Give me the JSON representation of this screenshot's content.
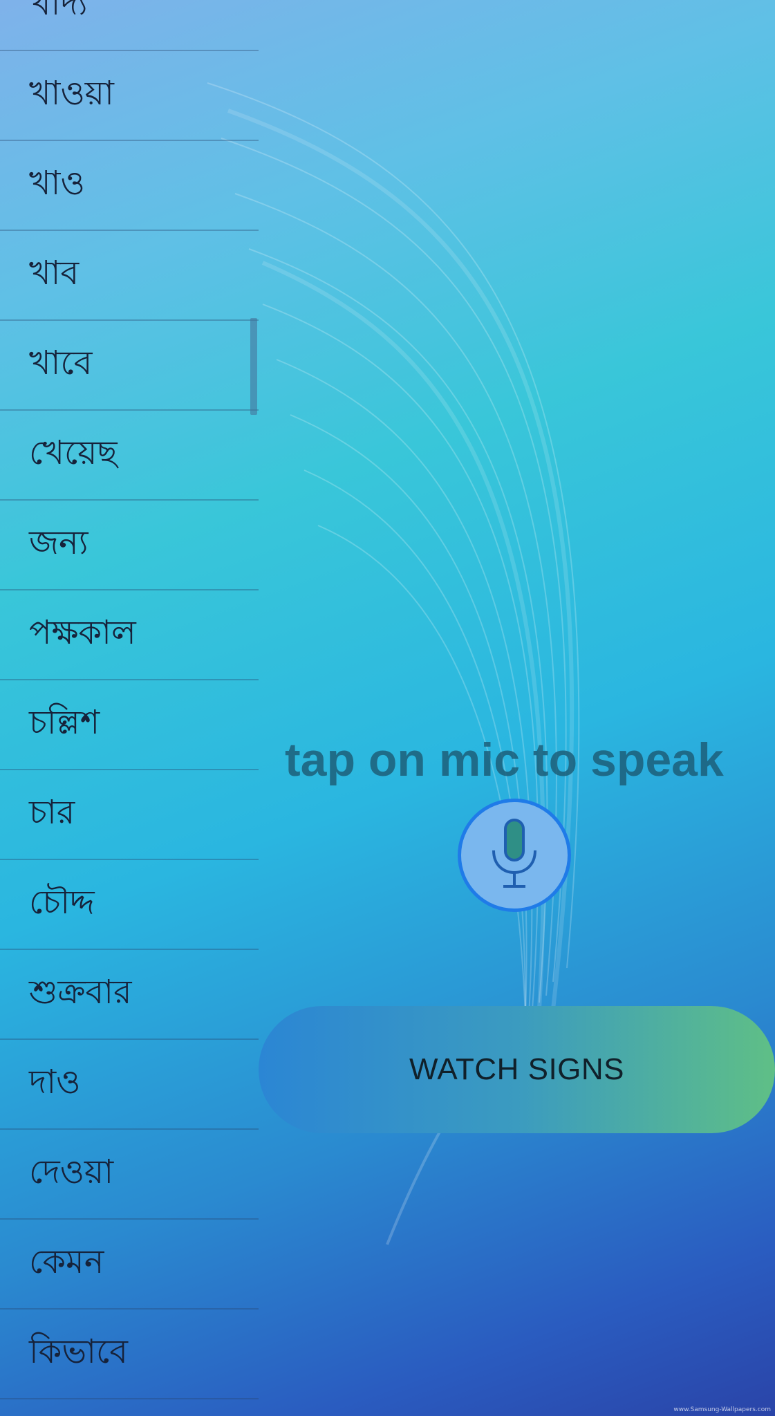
{
  "word_list": [
    "খাদ্য",
    "খাওয়া",
    "খাও",
    "খাব",
    "খাবে",
    "খেয়েছ",
    "জন্য",
    "পক্ষকাল",
    "চল্লিশ",
    "চার",
    "চৌদ্দ",
    "শুক্রবার",
    "দাও",
    "দেওয়া",
    "কেমন",
    "কিভাবে"
  ],
  "hint": "tap on mic to speak",
  "mic_icon": "microphone-icon",
  "watch_button": "WATCH SIGNS",
  "watermark": "www.Samsung-Wallpapers.com",
  "colors": {
    "mic_border": "#1f7be8",
    "mic_fill": "#7ab7ee",
    "button_gradient_start": "#2b86d4",
    "button_gradient_end": "#5fbf86"
  }
}
